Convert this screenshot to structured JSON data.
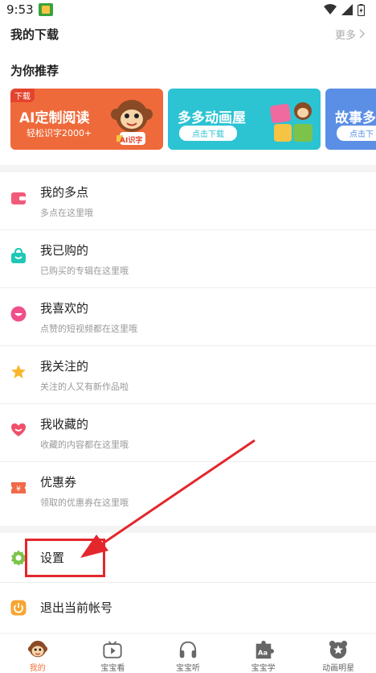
{
  "status_bar": {
    "time": "9:53"
  },
  "downloads": {
    "title": "我的下载",
    "more": "更多"
  },
  "recommend": {
    "title": "为你推荐",
    "banners": [
      {
        "badge": "下载",
        "title": "AI定制阅读",
        "subtitle": "轻松识字2000+",
        "logo_text": "AI识字",
        "color": "#ef6a3a"
      },
      {
        "title": "多多动画屋",
        "button": "点击下载",
        "color": "#2cc3d3"
      },
      {
        "title": "故事多",
        "button": "点击下",
        "color": "#5b8fe6"
      }
    ]
  },
  "menu": [
    {
      "label": "我的多点",
      "desc": "多点在这里哦",
      "icon": "wallet-icon",
      "color": "#f25a7a"
    },
    {
      "label": "我已购的",
      "desc": "已购买的专辑在这里哦",
      "icon": "shopping-bag-icon",
      "color": "#1ec7b6"
    },
    {
      "label": "我喜欢的",
      "desc": "点赞的短视频都在这里哦",
      "icon": "smile-icon",
      "color": "#f04f8a"
    },
    {
      "label": "我关注的",
      "desc": "关注的人又有新作品啦",
      "icon": "star-icon",
      "color": "#f8b62b"
    },
    {
      "label": "我收藏的",
      "desc": "收藏的内容都在这里哦",
      "icon": "heart-icon",
      "color": "#f04f6a"
    },
    {
      "label": "优惠券",
      "desc": "领取的优惠券在这里哦",
      "icon": "coupon-icon",
      "color": "#f06a4a"
    }
  ],
  "settings": {
    "label": "设置",
    "icon": "gear-icon",
    "color": "#7bc34a"
  },
  "logout": {
    "label": "退出当前帐号",
    "icon": "power-icon",
    "color": "#f7a531"
  },
  "bottom_nav": [
    {
      "label": "我的",
      "icon": "monkey-icon",
      "active": true
    },
    {
      "label": "宝宝看",
      "icon": "play-icon",
      "active": false
    },
    {
      "label": "宝宝听",
      "icon": "headphones-icon",
      "active": false
    },
    {
      "label": "宝宝学",
      "icon": "puzzle-icon",
      "active": false
    },
    {
      "label": "动画明星",
      "icon": "bear-star-icon",
      "active": false
    }
  ],
  "colors": {
    "accent": "#f0713a",
    "annotation_red": "#e3272d"
  }
}
